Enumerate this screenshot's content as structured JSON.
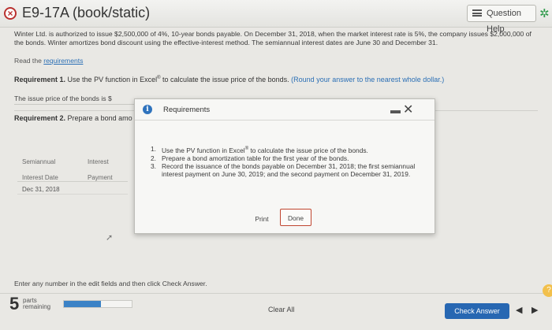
{
  "header": {
    "title": "E9-17A (book/static)",
    "help_label": "Question Help"
  },
  "intro": "Winter Ltd. is authorized to issue $2,500,000 of 4%, 10-year bonds payable. On December 31, 2018, when the market interest rate is 5%, the company issues $2,000,000 of the bonds. Winter amortizes bond discount using the effective-interest method. The semiannual interest dates are June 30 and December 31.",
  "read_prefix": "Read the",
  "read_link": "requirements",
  "req1": {
    "label": "Requirement 1.",
    "text_a": "Use the PV function in Excel",
    "sup": "®",
    "text_b": "to calculate the issue price of the bonds.",
    "hint": "(Round your answer to the nearest whole dollar.)"
  },
  "issue_price_label": "The issue price of the bonds is $",
  "req2": {
    "label": "Requirement 2.",
    "text": "Prepare a bond amo"
  },
  "table": {
    "col1_line1": "Semiannual",
    "col1_line2": "Interest Date",
    "col2_line1": "Interest",
    "col2_line2": "Payment",
    "row1_date": "Dec 31, 2018"
  },
  "footer_note": "Enter any number in the edit fields and then click Check Answer.",
  "parts": {
    "count": "5",
    "line1": "parts",
    "line2": "remaining",
    "progress_fraction": 0.55
  },
  "buttons": {
    "clear_all": "Clear All",
    "check_answer": "Check Answer"
  },
  "dialog": {
    "title": "Requirements",
    "items": [
      {
        "num": "1.",
        "text_a": "Use the PV function in Excel",
        "sup": "®",
        "text_b": "to calculate the issue price of the bonds."
      },
      {
        "num": "2.",
        "text": "Prepare a bond amortization table for the first year of the bonds."
      },
      {
        "num": "3.",
        "text": "Record the issuance of the bonds payable on December 31, 2018; the first semiannual interest payment on June 30, 2019; and the second payment on December 31, 2019."
      }
    ],
    "print_label": "Print",
    "done_label": "Done"
  },
  "colors": {
    "accent_blue": "#2767b2",
    "done_border": "#c0452f",
    "error_red": "#b9312f"
  },
  "icons": [
    "close-circle-icon",
    "menu-lines-icon",
    "gear-icon",
    "info-icon",
    "minimize-icon",
    "close-icon",
    "chevron-left-icon",
    "chevron-right-icon",
    "help-icon"
  ]
}
